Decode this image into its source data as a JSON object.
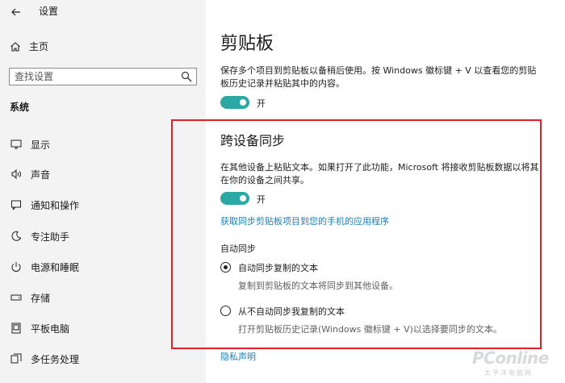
{
  "window": {
    "title": "设置"
  },
  "sidebar": {
    "home_label": "主页",
    "search_placeholder": "查找设置",
    "section_title": "系统",
    "items": [
      {
        "label": "显示",
        "icon": "monitor-icon"
      },
      {
        "label": "声音",
        "icon": "speaker-icon"
      },
      {
        "label": "通知和操作",
        "icon": "notification-icon"
      },
      {
        "label": "专注助手",
        "icon": "moon-icon"
      },
      {
        "label": "电源和睡眠",
        "icon": "power-icon"
      },
      {
        "label": "存储",
        "icon": "storage-icon"
      },
      {
        "label": "平板电脑",
        "icon": "tablet-icon"
      },
      {
        "label": "多任务处理",
        "icon": "multitask-icon"
      }
    ]
  },
  "main": {
    "title": "剪贴板",
    "history_desc": "保存多个项目到剪贴板以备稍后使用。按 Windows 徽标键 + V 以查看您的剪贴板历史记录并粘贴其中的内容。",
    "history_toggle": {
      "state": "on",
      "label": "开"
    },
    "sync": {
      "title": "跨设备同步",
      "desc": "在其他设备上粘贴文本。如果打开了此功能，Microsoft 将接收剪贴板数据以将其在你的设备之间共享。",
      "toggle": {
        "state": "on",
        "label": "开"
      },
      "link": "获取同步剪贴板项目到您的手机的应用程序",
      "auto_sync_label": "自动同步",
      "options": [
        {
          "label": "自动同步复制的文本",
          "desc": "复制到剪贴板的文本将同步到其他设备。",
          "selected": true
        },
        {
          "label": "从不自动同步我复制的文本",
          "desc": "打开剪贴板历史记录(Windows 徽标键 + V)以选择要同步的文本。",
          "selected": false
        }
      ]
    },
    "privacy_link": "隐私声明"
  },
  "colors": {
    "accent": "#2aa8a5",
    "link": "#1a7fba",
    "highlight": "#e11f27"
  },
  "watermark": {
    "logo": "PConline",
    "sub": "太平洋电脑网"
  }
}
